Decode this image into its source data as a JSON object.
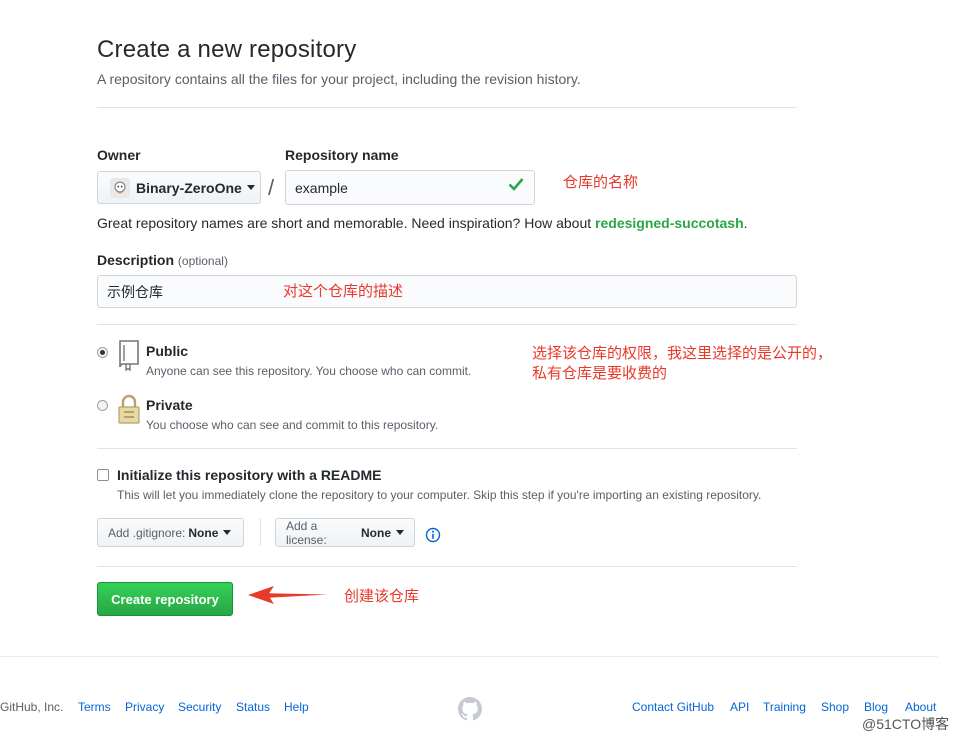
{
  "header": {
    "title": "Create a new repository",
    "subtitle": "A repository contains all the files for your project, including the revision history."
  },
  "owner": {
    "label": "Owner",
    "value": "Binary-ZeroOne"
  },
  "separator": "/",
  "repo_name": {
    "label": "Repository name",
    "value": "example"
  },
  "name_hint": {
    "text": "Great repository names are short and memorable. Need inspiration? How about ",
    "suggestion": "redesigned-succotash",
    "end": "."
  },
  "description": {
    "label": "Description",
    "optional": "(optional)",
    "value": "示例仓库"
  },
  "visibility": {
    "public": {
      "title": "Public",
      "desc": "Anyone can see this repository. You choose who can commit.",
      "selected": true
    },
    "private": {
      "title": "Private",
      "desc": "You choose who can see and commit to this repository.",
      "selected": false
    }
  },
  "readme": {
    "label": "Initialize this repository with a README",
    "desc": "This will let you immediately clone the repository to your computer. Skip this step if you're importing an existing repository.",
    "checked": false
  },
  "gitignore": {
    "label": "Add .gitignore:",
    "value": "None"
  },
  "license": {
    "label": "Add a license:",
    "value": "None"
  },
  "create_button": "Create repository",
  "annotations": {
    "name": "仓库的名称",
    "description": "对这个仓库的描述",
    "visibility_line1": "选择该仓库的权限，我这里选择的是公开的，",
    "visibility_line2": "私有仓库是要收费的",
    "create": "创建该仓库"
  },
  "footer": {
    "copyright": "GitHub, Inc.",
    "left_links": [
      "Terms",
      "Privacy",
      "Security",
      "Status",
      "Help"
    ],
    "right_links": [
      "Contact GitHub",
      "API",
      "Training",
      "Shop",
      "Blog",
      "About"
    ]
  },
  "watermark": "@51CTO博客",
  "colors": {
    "accent_green": "#28a745",
    "link_blue": "#0366d6",
    "annotation_red": "#e8392b"
  }
}
